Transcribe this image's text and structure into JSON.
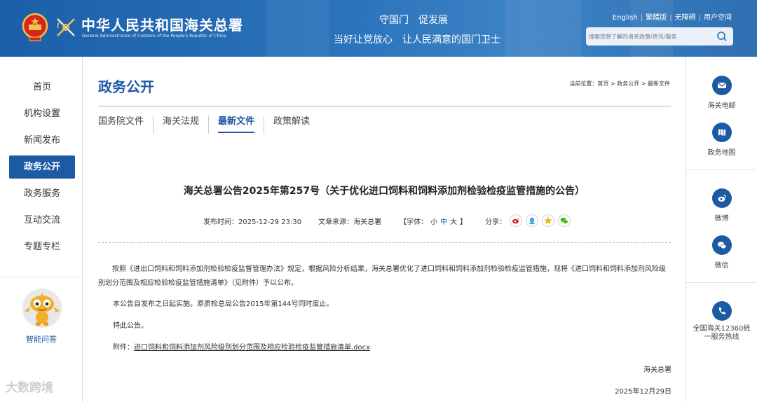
{
  "header": {
    "org_name_cn": "中华人民共和国海关总署",
    "org_name_en": "General Administration of Customs of the People's Republic of China",
    "slogan_line1": "守国门　促发展",
    "slogan_line2": "当好让党放心　让人民满意的国门卫士",
    "top_links": [
      "English",
      "繁體版",
      "无障碍",
      "用户空间"
    ],
    "search_placeholder": "搜索您想了解的海关政策/资讯/服务"
  },
  "sidebar": {
    "items": [
      {
        "label": "首页",
        "active": false
      },
      {
        "label": "机构设置",
        "active": false
      },
      {
        "label": "新闻发布",
        "active": false
      },
      {
        "label": "政务公开",
        "active": true
      },
      {
        "label": "政务服务",
        "active": false
      },
      {
        "label": "互动交流",
        "active": false
      },
      {
        "label": "专题专栏",
        "active": false
      }
    ],
    "assistant_label": "智能问答"
  },
  "main": {
    "section_title": "政务公开",
    "breadcrumb": "当前位置：首页 > 政务公开 > 最新文件",
    "tabs": [
      {
        "label": "国务院文件",
        "active": false
      },
      {
        "label": "海关法规",
        "active": false
      },
      {
        "label": "最新文件",
        "active": true
      },
      {
        "label": "政策解读",
        "active": false
      }
    ],
    "article": {
      "title": "海关总署公告2025年第257号（关于优化进口饲料和饲料添加剂检验检疫监管措施的公告）",
      "publish_time": "发布时间：2025-12-29 23:30",
      "source": "文章来源：海关总署",
      "font_label": "【字体：",
      "font_small": "小",
      "font_medium": "中",
      "font_large": "大",
      "font_close": "】",
      "share_label": "分享：",
      "share_icons": [
        "weibo-icon",
        "qq-icon",
        "qzone-icon",
        "wechat-icon"
      ],
      "paragraph1": "按照《进出口饲料和饲料添加剂检验检疫监督管理办法》规定，根据风险分析结果，海关总署优化了进口饲料和饲料添加剂检验检疫监管措施，现将《进口饲料和饲料添加剂风险级别划分范围及相应检验检疫监管措施清单》（见附件）予以公布。",
      "paragraph2": "本公告自发布之日起实施。原质检总局公告2015年第144号同时废止。",
      "paragraph3": "特此公告。",
      "attachment_label": "附件：",
      "attachment_link": "进口饲料和饲料添加剂风险级别划分范围及相应检验检疫监管措施清单.docx",
      "signature": "海关总署",
      "date": "2025年12月29日"
    }
  },
  "right_rail": {
    "items": [
      {
        "label": "海关电邮",
        "icon": "mail-icon"
      },
      {
        "label": "政务地图",
        "icon": "map-icon"
      },
      {
        "label": "微博",
        "icon": "weibo-icon"
      },
      {
        "label": "微信",
        "icon": "wechat-icon"
      },
      {
        "label": "全国海关12360统一服务热线",
        "icon": "phone-icon"
      }
    ]
  },
  "watermark": "大数跨境",
  "colors": {
    "primary": "#1c5aa4",
    "header_bg": "#2a73bb",
    "divider": "#d6e1ee"
  }
}
